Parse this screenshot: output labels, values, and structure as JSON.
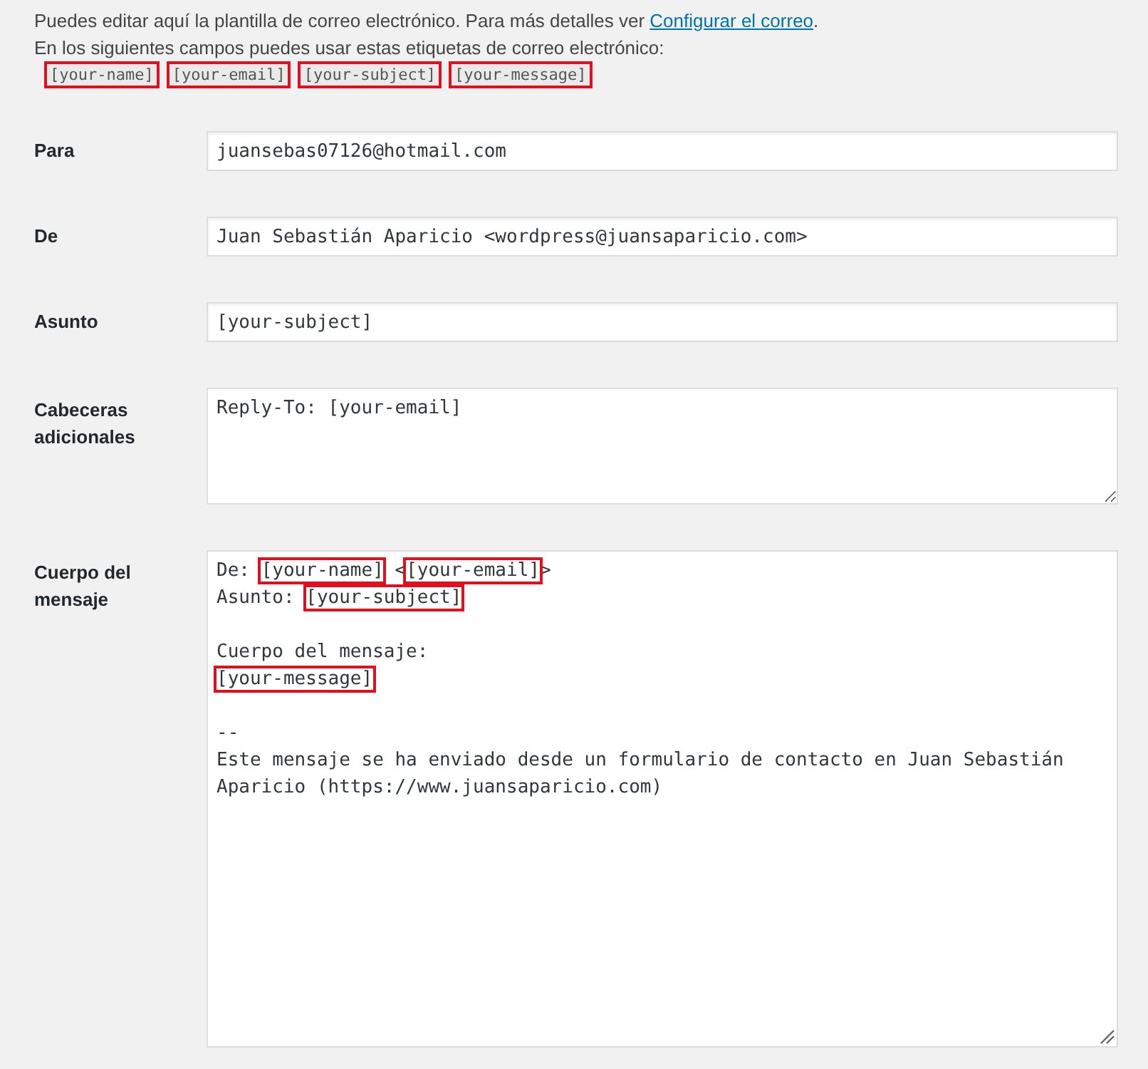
{
  "intro": {
    "text": "Puedes editar aquí la plantilla de correo electrónico. Para más detalles ver ",
    "link": "Configurar el correo",
    "after": ".",
    "tags_text": "En los siguientes campos puedes usar estas etiquetas de correo electrónico:"
  },
  "tags": [
    {
      "label": "[your-name]",
      "highlighted": true
    },
    {
      "label": "[your-email]",
      "highlighted": true
    },
    {
      "label": "[your-subject]",
      "highlighted": true
    },
    {
      "label": "[your-message]",
      "highlighted": true
    }
  ],
  "fields": [
    {
      "kind": "input",
      "label": "Para",
      "value": "juansebas07126@hotmail.com"
    },
    {
      "kind": "input",
      "label": "De",
      "value": "Juan Sebastián Aparicio <wordpress@juansaparicio.com>"
    },
    {
      "kind": "input",
      "label": "Asunto",
      "value": "[your-subject]"
    },
    {
      "kind": "textarea",
      "label": "Cabeceras adicionales",
      "value": "Reply-To: [your-email]"
    }
  ],
  "body": {
    "label": "Cuerpo del mensaje",
    "lines": [
      {
        "kind": "text",
        "segments": [
          {
            "text": "De: ",
            "highlighted": false
          },
          {
            "text": "[your-name]",
            "highlighted": true
          },
          {
            "text": " <",
            "highlighted": false
          },
          {
            "text": "[your-email]",
            "highlighted": true
          },
          {
            "text": ">",
            "highlighted": false
          }
        ]
      },
      {
        "kind": "text",
        "segments": [
          {
            "text": "Asunto: ",
            "highlighted": false
          },
          {
            "text": "[your-subject]",
            "highlighted": true
          }
        ]
      },
      {
        "kind": "blank"
      },
      {
        "kind": "text",
        "segments": [
          {
            "text": "Cuerpo del mensaje:",
            "highlighted": false
          }
        ]
      },
      {
        "kind": "text",
        "segments": [
          {
            "text": "[your-message]",
            "highlighted": true
          }
        ]
      },
      {
        "kind": "blank"
      },
      {
        "kind": "text",
        "segments": [
          {
            "text": "--",
            "highlighted": false
          }
        ]
      },
      {
        "kind": "text",
        "segments": [
          {
            "text": "Este mensaje se ha enviado desde un formulario de contacto en Juan Sebastián",
            "highlighted": false
          }
        ]
      },
      {
        "kind": "text",
        "segments": [
          {
            "text": "Aparicio (https://www.juansaparicio.com)",
            "highlighted": false
          }
        ]
      }
    ]
  }
}
